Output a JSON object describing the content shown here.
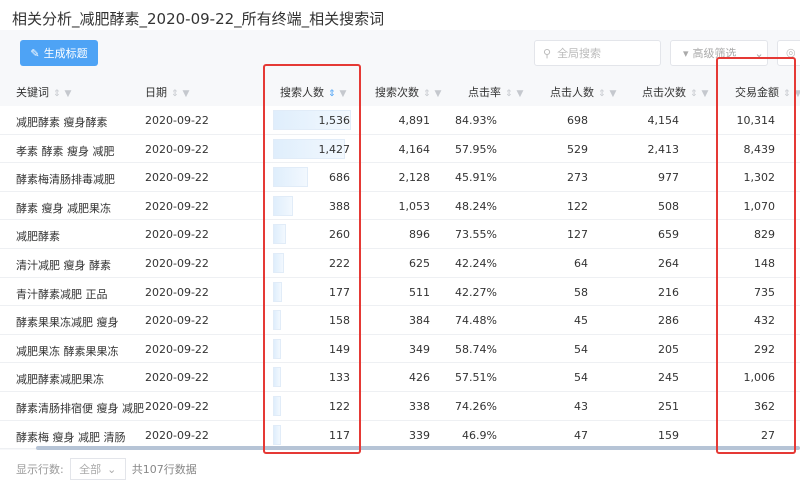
{
  "title": "相关分析_减肥酵素_2020-09-22_所有终端_相关搜索词",
  "toolbar": {
    "generate_label": "生成标题",
    "search_placeholder": "全局搜索",
    "filter_label": "高级筛选"
  },
  "columns": [
    "关键词",
    "日期",
    "搜索人数",
    "搜索次数",
    "点击率",
    "点击人数",
    "点击次数",
    "交易金额"
  ],
  "sorted_column": "搜索人数",
  "accent": "#4ea3f5",
  "highlight_color": "#e53935",
  "rows": [
    [
      "减肥酵素 瘦身酵素",
      "2020-09-22",
      "1,536",
      "4,891",
      "84.93%",
      "698",
      "4,154",
      "10,314"
    ],
    [
      "孝素 酵素 瘦身 减肥",
      "2020-09-22",
      "1,427",
      "4,164",
      "57.95%",
      "529",
      "2,413",
      "8,439"
    ],
    [
      "酵素梅清肠排毒减肥",
      "2020-09-22",
      "686",
      "2,128",
      "45.91%",
      "273",
      "977",
      "1,302"
    ],
    [
      "酵素 瘦身 减肥果冻",
      "2020-09-22",
      "388",
      "1,053",
      "48.24%",
      "122",
      "508",
      "1,070"
    ],
    [
      "减肥酵素",
      "2020-09-22",
      "260",
      "896",
      "73.55%",
      "127",
      "659",
      "829"
    ],
    [
      "清汁减肥 瘦身 酵素",
      "2020-09-22",
      "222",
      "625",
      "42.24%",
      "64",
      "264",
      "148"
    ],
    [
      "青汁酵素减肥 正品",
      "2020-09-22",
      "177",
      "511",
      "42.27%",
      "58",
      "216",
      "735"
    ],
    [
      "酵素果果冻减肥 瘦身",
      "2020-09-22",
      "158",
      "384",
      "74.48%",
      "45",
      "286",
      "432"
    ],
    [
      "减肥果冻 酵素果果冻",
      "2020-09-22",
      "149",
      "349",
      "58.74%",
      "54",
      "205",
      "292"
    ],
    [
      "减肥酵素减肥果冻",
      "2020-09-22",
      "133",
      "426",
      "57.51%",
      "54",
      "245",
      "1,006"
    ],
    [
      "酵素清肠排宿便 瘦身 减肥",
      "2020-09-22",
      "122",
      "338",
      "74.26%",
      "43",
      "251",
      "362"
    ],
    [
      "酵素梅 瘦身 减肥 清肠",
      "2020-09-22",
      "117",
      "339",
      "46.9%",
      "47",
      "159",
      "27"
    ]
  ],
  "footer": {
    "rows_label": "显示行数:",
    "rows_value": "全部",
    "total": "共107行数据"
  }
}
